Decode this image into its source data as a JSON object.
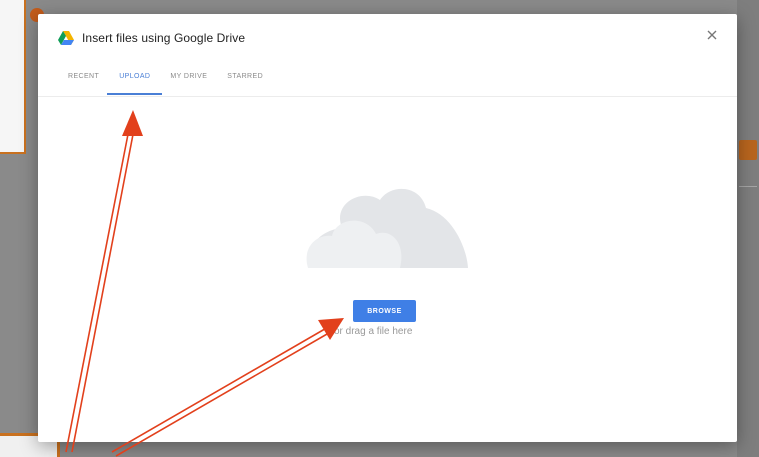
{
  "dialog": {
    "title": "Insert files using Google Drive",
    "close_icon": "close-icon",
    "drive_icon": "google-drive-icon",
    "tabs": [
      {
        "label": "RECENT",
        "active": false
      },
      {
        "label": "UPLOAD",
        "active": true
      },
      {
        "label": "MY DRIVE",
        "active": false
      },
      {
        "label": "STARRED",
        "active": false
      }
    ],
    "upload": {
      "illustration": "cloud-icon",
      "browse_label": "BROWSE",
      "drag_text": "or drag a file here"
    }
  },
  "colors": {
    "accent": "#3f7fe6",
    "annotation": "#e2401c",
    "highlight_border": "#c9711f"
  }
}
